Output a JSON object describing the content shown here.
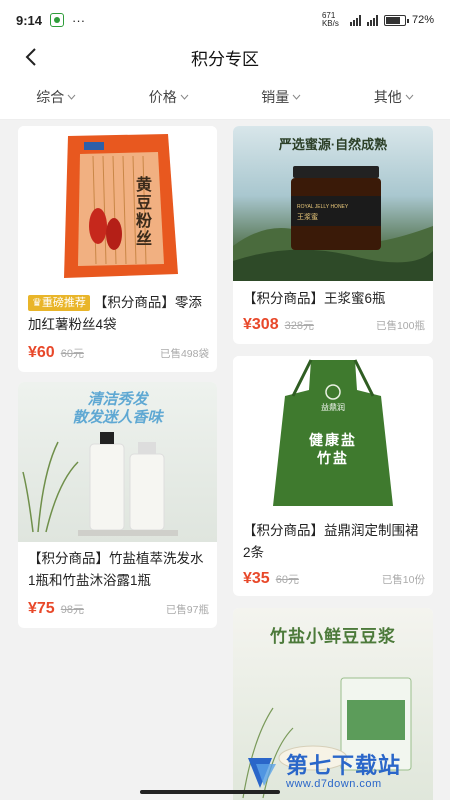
{
  "status": {
    "time": "9:14",
    "dots": "···",
    "net_speed": "671 KB/s",
    "battery": "72%"
  },
  "nav": {
    "title": "积分专区"
  },
  "sort": [
    "综合",
    "价格",
    "销量",
    "其他"
  ],
  "products": [
    {
      "badge": "重磅推荐",
      "title": "【积分商品】零添加红薯粉丝4袋",
      "price": "¥60",
      "orig": "60元",
      "sold": "已售498袋",
      "image_text": "黄豆粉丝"
    },
    {
      "title": "【积分商品】王浆蜜6瓶",
      "price": "¥308",
      "orig": "328元",
      "sold": "已售100瓶",
      "image_text": "严选蜜源·自然成熟",
      "image_subtext": "ROYAL JELLY HONEY",
      "image_label": "王浆蜜"
    },
    {
      "title": "【积分商品】竹盐植萃洗发水1瓶和竹盐沐浴露1瓶",
      "price": "¥75",
      "orig": "98元",
      "sold": "已售97瓶",
      "image_text": "清洁秀发",
      "image_text2": "散发迷人香味"
    },
    {
      "title": "【积分商品】益鼎润定制围裙2条",
      "price": "¥35",
      "orig": "60元",
      "sold": "已售10份",
      "image_brand": "益鼎润",
      "image_text": "健康盐",
      "image_text2": "竹盐"
    },
    {
      "title": "",
      "image_text": "竹盐小鲜豆豆浆"
    }
  ],
  "watermark": {
    "name": "第七下载站",
    "url": "www.d7down.com"
  },
  "colors": {
    "price": "#e8482a",
    "badge": "#e9b529",
    "watermark": "#2a66c9"
  }
}
